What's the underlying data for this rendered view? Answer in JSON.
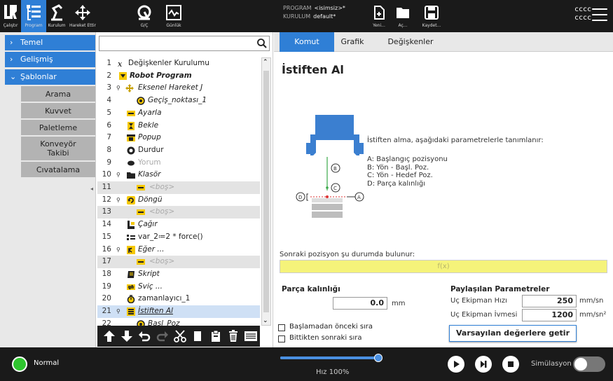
{
  "header": {
    "nav_buttons": [
      {
        "label": "Çalıştır",
        "icon": "ur-logo-icon"
      },
      {
        "label": "Program",
        "icon": "program-icon"
      },
      {
        "label": "Kurulum",
        "icon": "installation-icon"
      },
      {
        "label": "Hareket Ettir",
        "icon": "move-icon"
      },
      {
        "label": "G/Ç",
        "icon": "io-icon"
      },
      {
        "label": "Günlük",
        "icon": "log-icon"
      }
    ],
    "program_label": "PROGRAM",
    "program_value": "<isimsiz>*",
    "installation_label": "KURULUM",
    "installation_value": "default*",
    "file_buttons": [
      {
        "label": "Yeni...",
        "icon": "new-file-icon"
      },
      {
        "label": "Aç...",
        "icon": "open-folder-icon"
      },
      {
        "label": "Kaydet...",
        "icon": "save-icon"
      }
    ],
    "user_line1": "cccc",
    "user_line2": "cccc"
  },
  "leftnav": {
    "items": [
      {
        "label": "Temel",
        "chevron": "›"
      },
      {
        "label": "Gelişmiş",
        "chevron": "›"
      },
      {
        "label": "Şablonlar",
        "chevron": "⌄"
      }
    ],
    "sub_items": [
      "Arama",
      "Kuvvet",
      "Paletleme",
      "Konveyör Takibi",
      "Cıvatalama"
    ]
  },
  "tree": {
    "search_placeholder": "",
    "rows": [
      {
        "num": "1",
        "text": "Değişkenler Kurulumu",
        "icon": "variables-icon"
      },
      {
        "num": "2",
        "text": "Robot Program",
        "icon": "robot-program-icon"
      },
      {
        "num": "3",
        "text": "Eksenel Hareket J",
        "icon": "movej-icon"
      },
      {
        "num": "4",
        "text": "Geçiş_noktası_1",
        "icon": "waypoint-icon"
      },
      {
        "num": "5",
        "text": "Ayarla",
        "icon": "set-icon"
      },
      {
        "num": "6",
        "text": "Bekle",
        "icon": "wait-icon"
      },
      {
        "num": "7",
        "text": "Popup",
        "icon": "popup-icon"
      },
      {
        "num": "8",
        "text": "Durdur",
        "icon": "halt-icon"
      },
      {
        "num": "9",
        "text": "Yorum",
        "icon": "comment-icon"
      },
      {
        "num": "10",
        "text": "Klasör",
        "icon": "folder-icon"
      },
      {
        "num": "11",
        "text": "<boş>",
        "icon": "empty-icon"
      },
      {
        "num": "12",
        "text": "Döngü",
        "icon": "loop-icon"
      },
      {
        "num": "13",
        "text": "<boş>",
        "icon": "empty-icon"
      },
      {
        "num": "14",
        "text": "Çağır",
        "icon": "call-icon"
      },
      {
        "num": "15",
        "text": "var_2≔2 * force()",
        "icon": "assignment-icon"
      },
      {
        "num": "16",
        "text": "Eğer ...",
        "icon": "if-icon"
      },
      {
        "num": "17",
        "text": "<boş>",
        "icon": "empty-icon"
      },
      {
        "num": "18",
        "text": "Skript",
        "icon": "script-icon"
      },
      {
        "num": "19",
        "text": "Sviç ...",
        "icon": "switch-icon"
      },
      {
        "num": "20",
        "text": "zamanlayıcı_1",
        "icon": "timer-icon"
      },
      {
        "num": "21",
        "text": "İstiften Al",
        "icon": "destack-icon"
      },
      {
        "num": "22",
        "text": "Başl_Poz",
        "icon": "waypoint-icon"
      }
    ]
  },
  "toolbar_icons": [
    "move-up-icon",
    "move-down-icon",
    "undo-icon",
    "redo-icon",
    "cut-icon",
    "copy-icon",
    "paste-icon",
    "delete-icon",
    "suppress-icon"
  ],
  "right": {
    "tabs": [
      "Komut",
      "Grafik",
      "Değişkenler"
    ],
    "title": "İstiften Al",
    "description": "İstiften alma, aşağıdaki parametrelerle tanımlanır:",
    "params": [
      "A: Başlangıç pozisyonu",
      "B: Yön - Başl. Poz.",
      "C: Yön - Hedef Poz.",
      "D: Parça kalınlığı"
    ],
    "diagram_labels": {
      "a": "A",
      "b": "B",
      "c": "C",
      "d": "D"
    },
    "next_position_label": "Sonraki pozisyon şu durumda bulunur:",
    "expression_placeholder": "f(x)",
    "part_thickness_label": "Parça kalınlığı",
    "part_thickness_value": "0.0",
    "part_thickness_unit": "mm",
    "shared_params_title": "Paylaşılan Parametreler",
    "tool_speed_label": "Uç Ekipman Hızı",
    "tool_speed_value": "250",
    "tool_speed_unit": "mm/sn",
    "tool_accel_label": "Uç Ekipman İvmesi",
    "tool_accel_value": "1200",
    "tool_accel_unit": "mm/sn²",
    "before_start_label": "Başlamadan önceki sıra",
    "after_end_label": "Bittikten sonraki sıra",
    "default_button": "Varsayılan değerlere getir"
  },
  "footer": {
    "status": "Normal",
    "speed": "Hız 100%",
    "speed_fraction": 1.0,
    "simulation": "Simülasyon",
    "simulation_on": false
  },
  "colors": {
    "accent": "#2f7fd6",
    "header_bg": "#1a1a1a",
    "status_ok": "#2ec52e",
    "expression_bg": "#f5f37a"
  }
}
